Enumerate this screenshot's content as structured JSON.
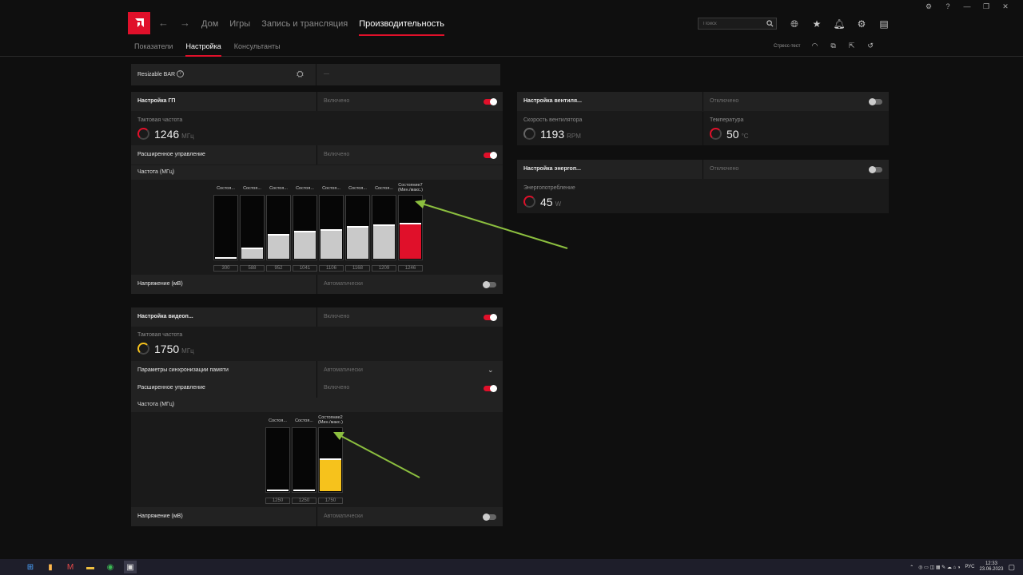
{
  "window": {
    "controls": [
      "⚙",
      "?",
      "—",
      "❐",
      "✕"
    ]
  },
  "nav": {
    "links": [
      "Дом",
      "Игры",
      "Запись и трансляция",
      "Производительность"
    ],
    "active": "Производительность",
    "search_placeholder": "Поиск"
  },
  "subnav": {
    "tabs": [
      "Показатели",
      "Настройка",
      "Консультанты"
    ],
    "active": "Настройка",
    "stress_test": "Стресс-тест"
  },
  "resizable_bar": {
    "label": "Resizable BAR",
    "value": "—"
  },
  "gpu": {
    "title": "Настройка ГП",
    "status": "Включено",
    "clock_label": "Тактовая частота",
    "clock_value": "1246",
    "clock_unit": "МГц",
    "advanced_label": "Расширенное управление",
    "advanced_status": "Включено",
    "freq_label": "Частота (МГц)",
    "states": [
      {
        "label": "Состоя...",
        "value": "300"
      },
      {
        "label": "Состоя...",
        "value": "588"
      },
      {
        "label": "Состоя...",
        "value": "952"
      },
      {
        "label": "Состоя...",
        "value": "1041"
      },
      {
        "label": "Состоя...",
        "value": "1106"
      },
      {
        "label": "Состоя...",
        "value": "1168"
      },
      {
        "label": "Состоя...",
        "value": "1209"
      },
      {
        "label": "Состояние7",
        "label2": "(Мин./макс.)",
        "value": "1246"
      }
    ],
    "fill_levels": [
      0.02,
      0.18,
      0.4,
      0.45,
      0.48,
      0.52,
      0.55,
      0.58
    ],
    "voltage_label": "Напряжение (мВ)",
    "voltage_status": "Автоматически"
  },
  "vram": {
    "title": "Настройка видеоп...",
    "status": "Включено",
    "clock_label": "Тактовая частота",
    "clock_value": "1750",
    "clock_unit": "МГц",
    "timing_label": "Параметры синхронизации памяти",
    "timing_status": "Автоматически",
    "advanced_label": "Расширенное управление",
    "advanced_status": "Включено",
    "freq_label": "Частота (МГц)",
    "states": [
      {
        "label": "Состоя...",
        "value": "1250"
      },
      {
        "label": "Состоя...",
        "value": "1250"
      },
      {
        "label": "Состояние2",
        "label2": "(Мин./макс.)",
        "value": "1750"
      }
    ],
    "fill_levels": [
      0.02,
      0.02,
      0.52
    ],
    "voltage_label": "Напряжение (мВ)",
    "voltage_status": "Автоматически"
  },
  "fan": {
    "title": "Настройка вентиля...",
    "status": "Отключено",
    "speed_label": "Скорость вентилятора",
    "speed_value": "1193",
    "speed_unit": "RPM",
    "temp_label": "Температура",
    "temp_value": "50",
    "temp_unit": "°C"
  },
  "power": {
    "title": "Настройка энергоп...",
    "status": "Отключено",
    "label": "Энергопотребление",
    "value": "45",
    "unit": "W"
  },
  "taskbar": {
    "lang": "РУС",
    "time": "12:33",
    "date": "23.06.2023"
  },
  "colors": {
    "accent": "#e0102a",
    "vram_bar": "#f6c21c",
    "arrow": "#8cbf3f"
  }
}
